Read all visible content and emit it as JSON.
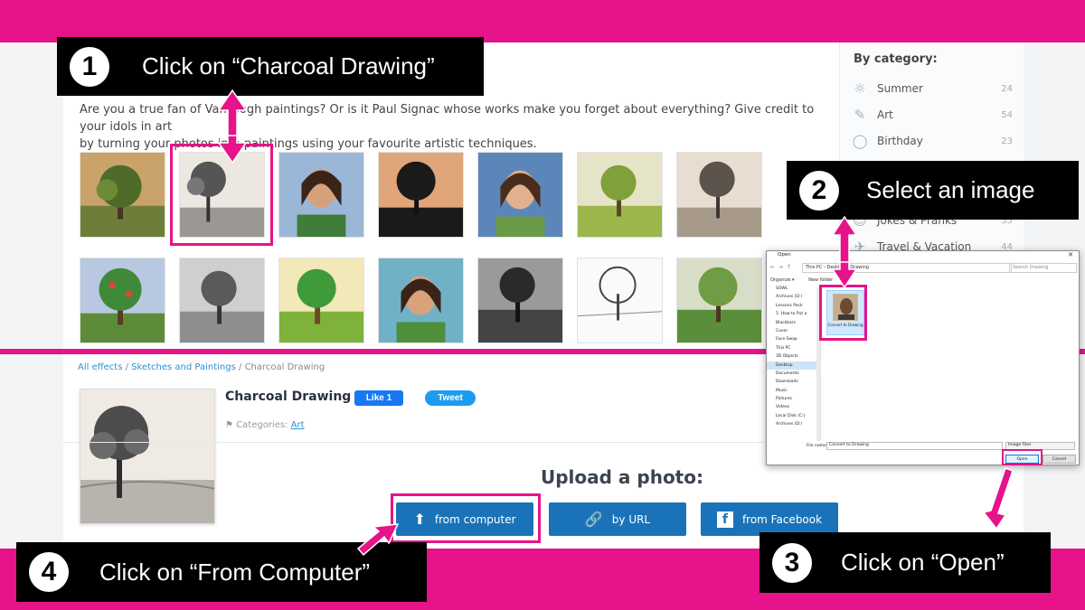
{
  "colors": {
    "accent_pink": "#e6138a",
    "button_blue": "#1a73b8",
    "link_blue": "#2f8fd0"
  },
  "callouts": [
    {
      "number": "1",
      "text": "Click on “Charcoal Drawing”"
    },
    {
      "number": "2",
      "text": "Select an image"
    },
    {
      "number": "3",
      "text": "Click on “Open”"
    },
    {
      "number": "4",
      "text": "Click on “From Computer”"
    }
  ],
  "gallery": {
    "intro_line1": "Are you a true fan of Van Gogh paintings? Or is it Paul Signac whose works make you forget about everything? Give credit to your idols in art",
    "intro_line2": "by turning your photos into paintings using your favourite artistic techniques."
  },
  "sidebar": {
    "title": "By category:",
    "items": [
      {
        "label": "Summer",
        "count": "24",
        "icon": "sun-icon"
      },
      {
        "label": "Art",
        "count": "54",
        "icon": "brush-icon"
      },
      {
        "label": "Birthday",
        "count": "23",
        "icon": "balloon-icon"
      },
      {
        "label": "Jokes & Pranks",
        "count": "55",
        "icon": "mask-icon"
      },
      {
        "label": "Travel & Vacation",
        "count": "44",
        "icon": "plane-icon"
      }
    ]
  },
  "effect_page": {
    "breadcrumb": [
      "All effects",
      "Sketches and Paintings",
      "Charcoal Drawing"
    ],
    "title": "Charcoal Drawing",
    "like_label": "Like 1",
    "tweet_label": "Tweet",
    "categories_label": "Categories:",
    "category": "Art",
    "upload_title": "Upload a photo:",
    "buttons": {
      "from_computer": "from computer",
      "by_url": "by URL",
      "from_facebook": "from Facebook"
    }
  },
  "dialog": {
    "title": "Open",
    "address": "This PC  ›  Desktop  ›  Drawing",
    "search_placeholder": "Search Drawing",
    "toolbar_organize": "Organize ▾",
    "toolbar_new_folder": "New folder",
    "tree": [
      "SOWL",
      "Archives (D:)",
      "Lessons Pack",
      "5. How to Put a",
      "Blackbars",
      "Cover",
      "Face Swap",
      "This PC",
      "3D Objects",
      "Desktop",
      "Documents",
      "Downloads",
      "Music",
      "Pictures",
      "Videos",
      "Local Disk (C:)",
      "Archives (D:)"
    ],
    "file_name": "Convert to Drawing",
    "file_name_label": "File name:",
    "file_name_value": "Convert to Drawing",
    "file_type": "Image Files",
    "open_label": "Open",
    "cancel_label": "Cancel"
  }
}
